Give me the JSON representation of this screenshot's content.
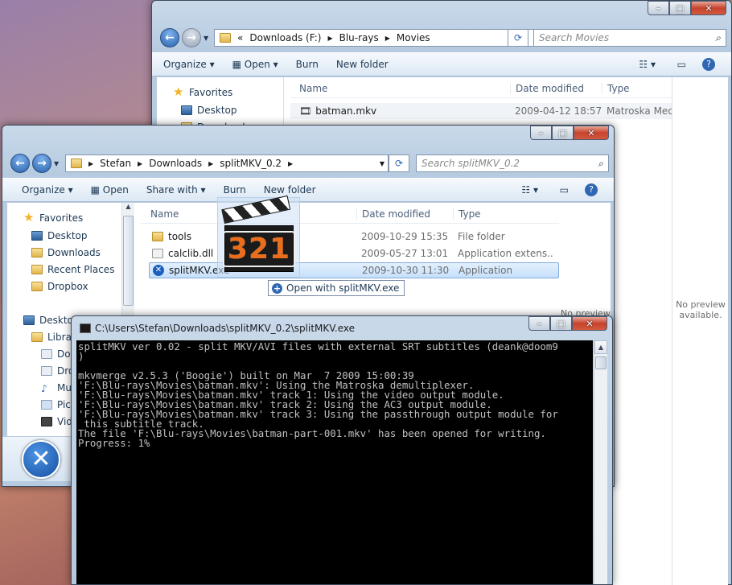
{
  "back_window": {
    "address": [
      "«",
      "Downloads (F:)",
      "Blu-rays",
      "Movies"
    ],
    "search_placeholder": "Search Movies",
    "toolbar": {
      "organize": "Organize",
      "open": "Open",
      "burn": "Burn",
      "new_folder": "New folder"
    },
    "nav": {
      "favorites": "Favorites",
      "desktop": "Desktop",
      "downloads": "Downloads"
    },
    "columns": {
      "name": "Name",
      "date": "Date modified",
      "type": "Type"
    },
    "files": [
      {
        "name": "batman.mkv",
        "date": "2009-04-12 18:57",
        "type": "Matroska Medi"
      }
    ],
    "no_preview": "No preview available."
  },
  "front_window": {
    "address": [
      "Stefan",
      "Downloads",
      "splitMKV_0.2"
    ],
    "search_placeholder": "Search splitMKV_0.2",
    "toolbar": {
      "organize": "Organize",
      "open": "Open",
      "share_with": "Share with",
      "burn": "Burn",
      "new_folder": "New folder"
    },
    "nav": {
      "favorites": "Favorites",
      "desktop": "Desktop",
      "downloads": "Downloads",
      "recent_places": "Recent Places",
      "dropbox": "Dropbox",
      "desktop2": "Desktop",
      "libraries": "Libra",
      "lib_items": [
        "Do",
        "Dro",
        "Mu",
        "Pic",
        "Vid"
      ]
    },
    "columns": {
      "name": "Name",
      "date": "Date modified",
      "type": "Type"
    },
    "files": [
      {
        "name": "tools",
        "date": "2009-10-29 15:35",
        "type": "File folder"
      },
      {
        "name": "calclib.dll",
        "date": "2009-05-27 13:01",
        "type": "Application extens..."
      },
      {
        "name": "splitMKV.exe",
        "date": "2009-10-30 11:30",
        "type": "Application"
      }
    ],
    "no_preview": "No preview",
    "drag_tooltip": "Open with splitMKV.exe"
  },
  "console": {
    "title": "C:\\Users\\Stefan\\Downloads\\splitMKV_0.2\\splitMKV.exe",
    "output": "splitMKV ver 0.02 - split MKV/AVI files with external SRT subtitles (deank@doom9\n)\n\nmkvmerge v2.5.3 ('Boogie') built on Mar  7 2009 15:00:39\n'F:\\Blu-rays\\Movies\\batman.mkv': Using the Matroska demultiplexer.\n'F:\\Blu-rays\\Movies\\batman.mkv' track 1: Using the video output module.\n'F:\\Blu-rays\\Movies\\batman.mkv' track 2: Using the AC3 output module.\n'F:\\Blu-rays\\Movies\\batman.mkv' track 3: Using the passthrough output module for\n this subtitle track.\nThe file 'F:\\Blu-rays\\Movies\\batman-part-001.mkv' has been opened for writing.\nProgress: 1%"
  },
  "drag_icon_text": "321"
}
